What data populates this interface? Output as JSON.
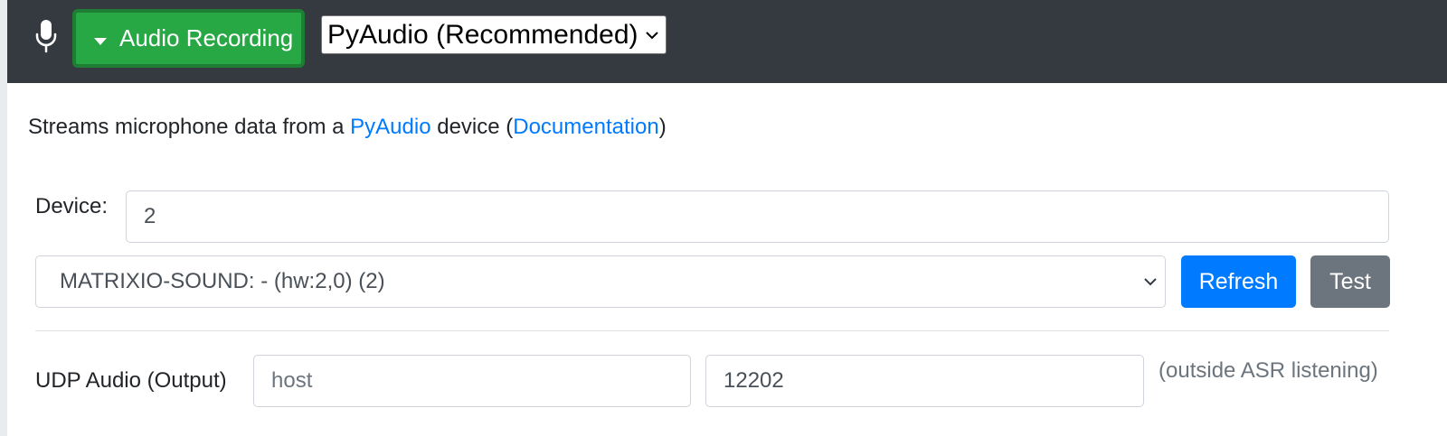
{
  "header": {
    "mic_icon": "microphone-icon",
    "recording_button_label": "Audio Recording",
    "engine_select_value": "PyAudio (Recommended)"
  },
  "description": {
    "prefix": "Streams microphone data from a ",
    "link_pyaudio": "PyAudio",
    "middle": " device (",
    "link_docs": "Documentation",
    "suffix": ")"
  },
  "device": {
    "label": "Device:",
    "value": "2",
    "select_value": "MATRIXIO-SOUND: - (hw:2,0) (2)",
    "refresh_label": "Refresh",
    "test_label": "Test"
  },
  "udp": {
    "label": "UDP Audio (Output)",
    "host_placeholder": "host",
    "port_value": "12202",
    "note": "(outside ASR listening)"
  },
  "colors": {
    "header_bg": "#343a40",
    "success": "#28a745",
    "primary": "#007bff",
    "secondary": "#6c757d"
  }
}
